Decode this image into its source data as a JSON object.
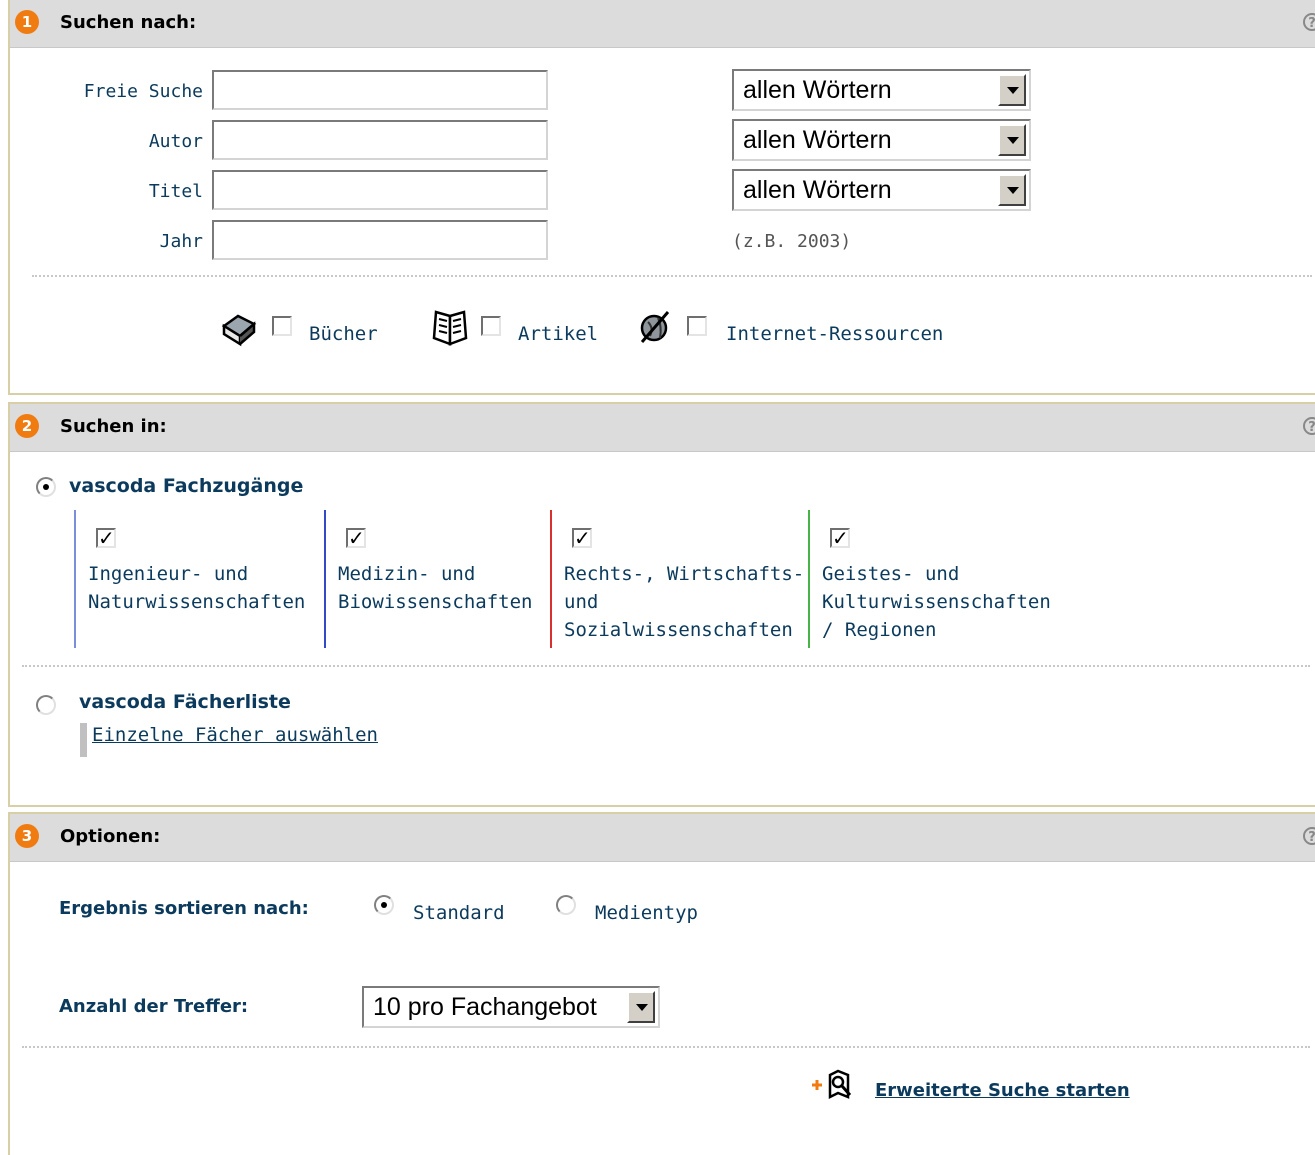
{
  "section1": {
    "number": "1",
    "title": "Suchen nach:",
    "help_glyph": "?",
    "fields": [
      {
        "label": "Freie Suche",
        "value": "",
        "mode": "allen Wörtern"
      },
      {
        "label": "Autor",
        "value": "",
        "mode": "allen Wörtern"
      },
      {
        "label": "Titel",
        "value": "",
        "mode": "allen Wörtern"
      },
      {
        "label": "Jahr",
        "value": "",
        "hint": "(z.B. 2003)"
      }
    ],
    "media": [
      {
        "icon": "book-icon",
        "label": "Bücher",
        "checked": false
      },
      {
        "icon": "article-icon",
        "label": "Artikel",
        "checked": false
      },
      {
        "icon": "globe-icon",
        "label": "Internet-Ressourcen",
        "checked": false
      }
    ]
  },
  "section2": {
    "number": "2",
    "title": "Suchen in:",
    "help_glyph": "?",
    "fachzugaenge": {
      "label": "vascoda Fachzugänge",
      "selected": true,
      "areas": [
        {
          "line1": "Ingenieur- und",
          "line2": "Naturwissenschaften",
          "line3": "",
          "checked": true,
          "color": "#7a8fd8"
        },
        {
          "line1": "Medizin- und",
          "line2": "Biowissenschaften",
          "line3": "",
          "checked": true,
          "color": "#3349c8"
        },
        {
          "line1": "Rechts-, Wirtschafts-",
          "line2": "und",
          "line3": "Sozialwissenschaften",
          "checked": true,
          "color": "#d83030"
        },
        {
          "line1": "Geistes- und",
          "line2": "Kulturwissenschaften",
          "line3": "/ Regionen",
          "checked": true,
          "color": "#48b448"
        }
      ]
    },
    "faecherliste": {
      "label": "vascoda Fächerliste",
      "selected": false,
      "link": "Einzelne Fächer auswählen"
    }
  },
  "section3": {
    "number": "3",
    "title": "Optionen:",
    "help_glyph": "?",
    "sort_label": "Ergebnis sortieren nach:",
    "sort_options": [
      {
        "label": "Standard",
        "selected": true
      },
      {
        "label": "Medientyp",
        "selected": false
      }
    ],
    "hits_label": "Anzahl der Treffer:",
    "hits_value": "10 pro Fachangebot",
    "start_link": "Erweiterte Suche starten"
  },
  "colors": {
    "accent": "#f07b10",
    "header_bg": "#dcdcdc",
    "text": "#0b3a5c",
    "section_border": "#d8cfa6"
  }
}
